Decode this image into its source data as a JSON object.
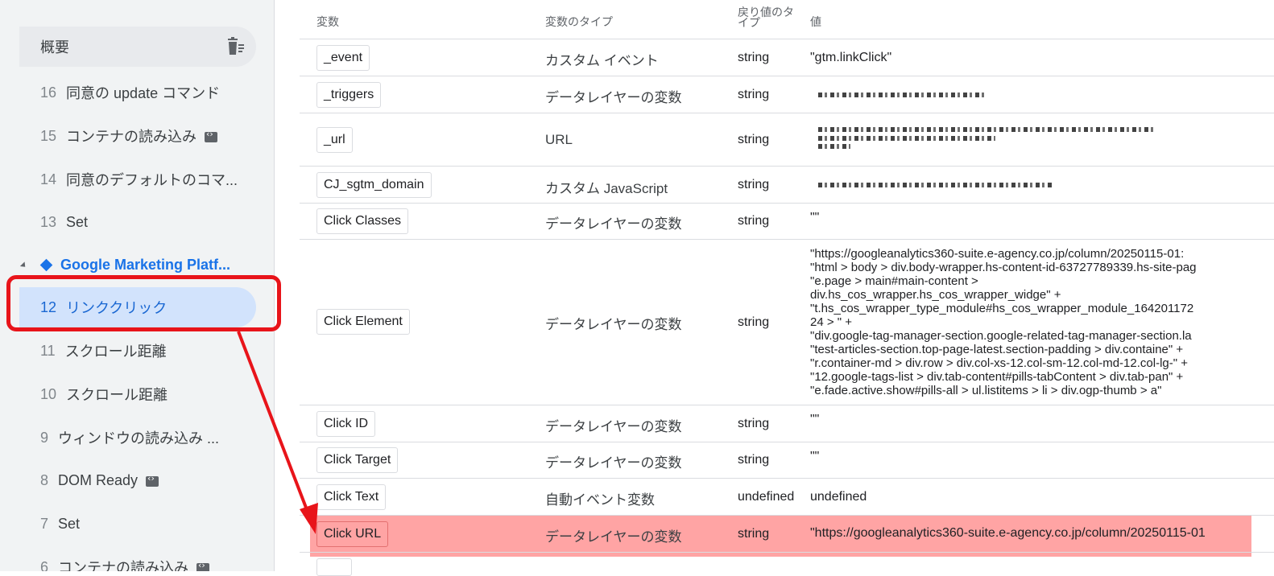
{
  "sidebar": {
    "summary_label": "概要",
    "items": [
      {
        "num": "16",
        "label": "同意の update コマンド",
        "badge": false
      },
      {
        "num": "15",
        "label": "コンテナの読み込み",
        "badge": true
      },
      {
        "num": "14",
        "label": "同意のデフォルトのコマ...",
        "badge": false
      },
      {
        "num": "13",
        "label": "Set",
        "badge": false
      },
      {
        "num": "",
        "label": "Google Marketing Platf...",
        "badge": false
      },
      {
        "num": "12",
        "label": "リンククリック",
        "badge": false
      },
      {
        "num": "11",
        "label": "スクロール距離",
        "badge": false
      },
      {
        "num": "10",
        "label": "スクロール距離",
        "badge": false
      },
      {
        "num": "9",
        "label": "ウィンドウの読み込み ...",
        "badge": false
      },
      {
        "num": "8",
        "label": "DOM Ready",
        "badge": true
      },
      {
        "num": "7",
        "label": "Set",
        "badge": false
      },
      {
        "num": "6",
        "label": "コンテナの読み込み",
        "badge": true
      }
    ]
  },
  "table": {
    "headers": {
      "variable": "変数",
      "type": "変数のタイプ",
      "return_type": "戻り値のタイプ",
      "value": "値"
    },
    "rows": [
      {
        "name": "_event",
        "type": "カスタム イベント",
        "ret": "string",
        "value": "\"gtm.linkClick\""
      },
      {
        "name": "_triggers",
        "type": "データレイヤーの変数",
        "ret": "string",
        "value": ""
      },
      {
        "name": "_url",
        "type": "URL",
        "ret": "string",
        "value": ""
      },
      {
        "name": "CJ_sgtm_domain",
        "type": "カスタム JavaScript",
        "ret": "string",
        "value": ""
      },
      {
        "name": "Click Classes",
        "type": "データレイヤーの変数",
        "ret": "string",
        "value": "\"\""
      },
      {
        "name": "Click Element",
        "type": "データレイヤーの変数",
        "ret": "string",
        "value_lines": [
          "\"https://googleanalytics360-suite.e-agency.co.jp/column/20250115-01:",
          "\"html > body > div.body-wrapper.hs-content-id-63727789339.hs-site-pag",
          "\"e.page > main#main-content >",
          "div.hs_cos_wrapper.hs_cos_wrapper_widge\" +",
          "\"t.hs_cos_wrapper_type_module#hs_cos_wrapper_module_164201172",
          "24 > \" +",
          "\"div.google-tag-manager-section.google-related-tag-manager-section.la",
          "\"test-articles-section.top-page-latest.section-padding > div.containe\" +",
          "\"r.container-md > div.row > div.col-xs-12.col-sm-12.col-md-12.col-lg-\" +",
          "\"12.google-tags-list > div.tab-content#pills-tabContent > div.tab-pan\" +",
          "\"e.fade.active.show#pills-all > ul.listitems > li > div.ogp-thumb > a\""
        ]
      },
      {
        "name": "Click ID",
        "type": "データレイヤーの変数",
        "ret": "string",
        "value": "\"\""
      },
      {
        "name": "Click Target",
        "type": "データレイヤーの変数",
        "ret": "string",
        "value": "\"\""
      },
      {
        "name": "Click Text",
        "type": "自動イベント変数",
        "ret": "undefined",
        "value": "undefined"
      },
      {
        "name": "Click URL",
        "type": "データレイヤーの変数",
        "ret": "string",
        "value": "\"https://googleanalytics360-suite.e-agency.co.jp/column/20250115-01"
      }
    ]
  }
}
